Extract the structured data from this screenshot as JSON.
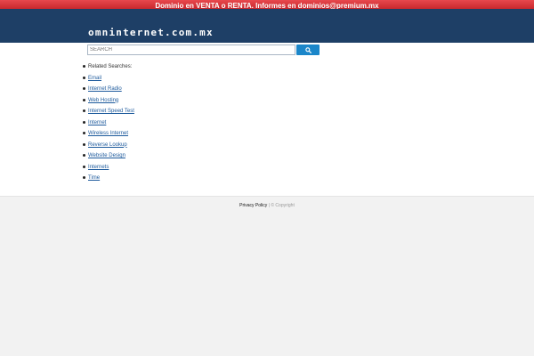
{
  "promo": {
    "text": "Dominio en VENTA o RENTA. Informes en dominios@premium.mx"
  },
  "header": {
    "site_title": "omninternet.com.mx"
  },
  "search": {
    "placeholder": "SEARCH",
    "button_icon": "search-icon"
  },
  "related": {
    "heading": "Related Searches:",
    "items": [
      "Email",
      "Internet Radio",
      "Web Hosting",
      "Internet Speed Test",
      "Internet",
      "Wireless Internet",
      "Reverse Lookup",
      "Website Design",
      "Internets",
      "Time"
    ]
  },
  "footer": {
    "privacy": "Privacy Policy",
    "separator": "|",
    "copyright": "© Copyright"
  },
  "colors": {
    "promo_red": "#d7363b",
    "header_blue": "#1e3f66",
    "button_blue": "#1b86c9",
    "link_blue": "#1d5a9c"
  }
}
